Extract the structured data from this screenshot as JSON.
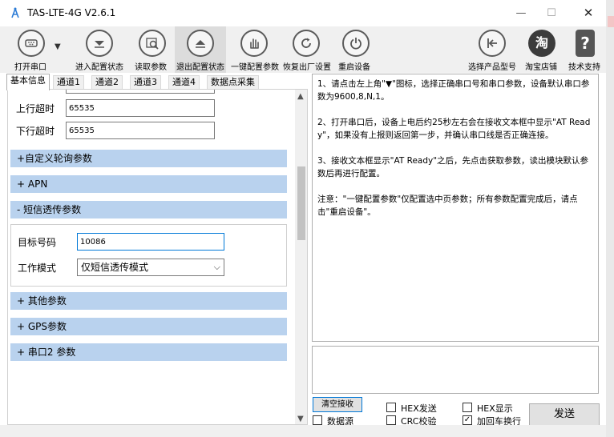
{
  "window": {
    "title": "TAS-LTE-4G V2.6.1",
    "min_glyph": "—",
    "max_glyph": "☐",
    "close_glyph": "✕"
  },
  "toolbar": {
    "open_port": "打开串口",
    "enter_config": "进入配置状态",
    "read_params": "读取参数",
    "exit_config": "退出配置状态",
    "one_key_config": "一键配置参数",
    "factory_reset": "恢复出厂设置",
    "restart": "重启设备",
    "select_model": "选择产品型号",
    "taobao": "淘宝店铺",
    "support": "技术支持",
    "dropdown_glyph": "▼",
    "taobao_glyph": "淘",
    "support_glyph": "?"
  },
  "tabs": [
    "基本信息",
    "通道1",
    "通道2",
    "通道3",
    "通道4",
    "数据点采集"
  ],
  "left": {
    "uplink_timeout_label": "上行超时",
    "uplink_timeout_value": "65535",
    "downlink_timeout_label": "下行超时",
    "downlink_timeout_value": "65535",
    "sections": {
      "custom_poll": "+自定义轮询参数",
      "apn": "+ APN",
      "sms": "- 短信透传参数",
      "other": "+ 其他参数",
      "gps": "+ GPS参数",
      "serial2": "+ 串口2 参数"
    },
    "sms": {
      "target_label": "目标号码",
      "target_value": "10086",
      "mode_label": "工作模式",
      "mode_value": "仅短信透传模式"
    }
  },
  "info": {
    "p1": "1、请点击左上角\"▼\"图标，选择正确串口号和串口参数，设备默认串口参数为9600,8,N,1。",
    "p2": "2、打开串口后，设备上电后约25秒左右会在接收文本框中显示\"AT Ready\"，如果没有上报则返回第一步，并确认串口线是否正确连接。",
    "p3": "3、接收文本框显示\"AT Ready\"之后，先点击获取参数，读出模块默认参数后再进行配置。",
    "p4": "注意：\"一键配置参数\"仅配置选中页参数；所有参数配置完成后，请点击\"重启设备\"。"
  },
  "bottom": {
    "clear_recv": "清空接收",
    "data_source": "数据源",
    "hex_send": "HEX发送",
    "crc_check": "CRC校验",
    "hex_display": "HEX显示",
    "add_crlf": "加回车换行",
    "add_crlf_checked": true,
    "send": "发送",
    "check_glyph": "✓"
  },
  "colors": {
    "section_bar": "#b9d2ee",
    "toolbar_bg": "#f0f0f0",
    "active_tool": "#dcdcdc"
  },
  "icons": {
    "app": "antenna-icon",
    "open_port": "serial-port-icon",
    "enter_config": "download-icon",
    "read_params": "magnifier-icon",
    "exit_config": "eject-icon",
    "one_key_config": "hand-icon",
    "factory_reset": "refresh-icon",
    "restart": "power-icon",
    "select_model": "back-arrow-icon",
    "taobao": "taobao-icon",
    "support": "question-icon"
  }
}
